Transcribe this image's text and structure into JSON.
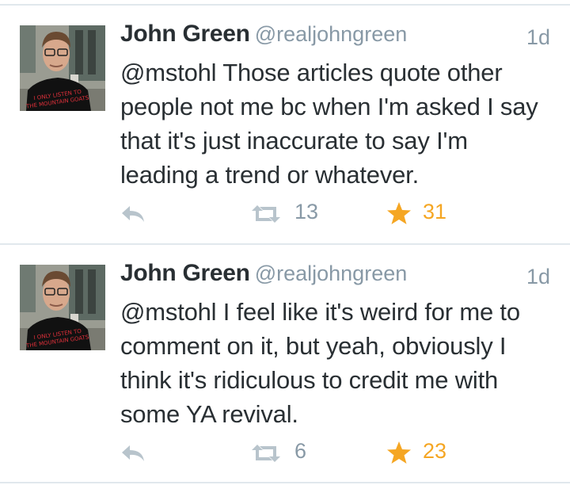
{
  "tweets": [
    {
      "name": "John Green",
      "handle": "@realjohngreen",
      "time": "1d",
      "text_lines": [
        "@mstohl Those articles quote other",
        "people not me bc when I'm asked I say",
        "that it's just inaccurate to say I'm",
        "leading a trend or whatever."
      ],
      "retweets": "13",
      "favorites": "31",
      "avatar_shirt_text": [
        "I ONLY LISTEN TO",
        "THE MOUNTAIN GOATS"
      ]
    },
    {
      "name": "John Green",
      "handle": "@realjohngreen",
      "time": "1d",
      "text_lines": [
        "@mstohl I feel like it's weird for me to",
        "comment on it, but yeah, obviously I",
        "think it's ridiculous to credit me with",
        "some YA revival."
      ],
      "retweets": "6",
      "favorites": "23",
      "avatar_shirt_text": [
        "I ONLY LISTEN TO",
        "THE MOUNTAIN GOATS"
      ]
    }
  ],
  "icons": {
    "reply": "reply-icon",
    "retweet": "retweet-icon",
    "favorite": "star-icon"
  },
  "colors": {
    "name": "#292f33",
    "secondary": "#8899a6",
    "action_icon": "#b8c4cc",
    "favorite": "#f5a623",
    "divider": "#e1e8ed"
  }
}
